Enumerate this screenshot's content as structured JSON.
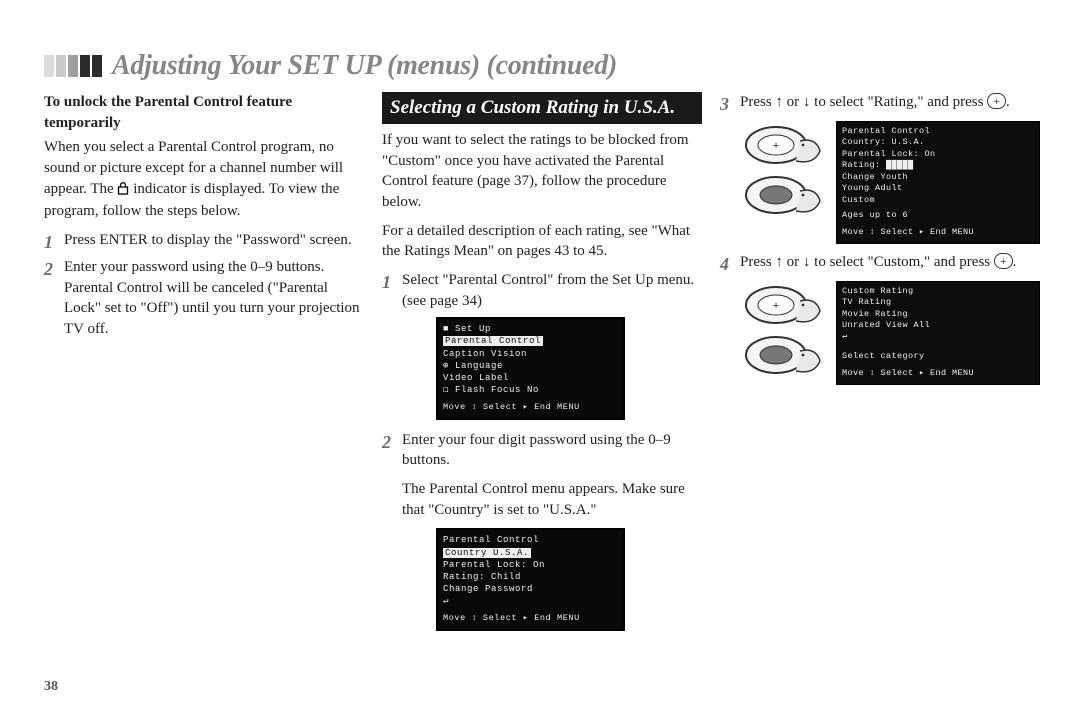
{
  "page_number": "38",
  "title": "Adjusting Your SET UP (menus) (continued)",
  "col1": {
    "subhead": "To unlock the Parental Control feature temporarily",
    "intro": "When you select a Parental Control program, no sound or picture except for a channel number will appear. The ",
    "intro2": " indicator is displayed. To view the program, follow the steps below.",
    "s1": "Press ENTER to display the \"Password\" screen.",
    "s2": "Enter your password using the 0–9 buttons. Parental Control will be canceled (\"Parental Lock\" set to \"Off\") until you turn your projection TV off."
  },
  "col2": {
    "boxtitle": "Selecting a Custom Rating in U.S.A.",
    "p1": "If you want to select the ratings to be blocked from \"Custom\" once you have activated the Parental Control feature (page 37), follow the procedure below.",
    "p2": "For a detailed description of each rating, see \"What the Ratings Mean\" on pages 43 to 45.",
    "s1": "Select \"Parental Control\" from the Set Up menu. (see page 34)",
    "s2a": "Enter your four digit password using the 0–9 buttons.",
    "s2b": "The Parental Control menu appears. Make sure that \"Country\" is set to \"U.S.A.\"",
    "osd1": {
      "title": "Set Up",
      "hl": "Parental Control",
      "l1": "Caption Vision",
      "l2": "Language",
      "l3": "Video Label",
      "l4": "Flash Focus    No",
      "foot": "Move ↕  Select ▸  End MENU"
    },
    "osd2": {
      "title": "Parental Control",
      "hl": "Country        U.S.A.",
      "l1": "Parental Lock: On",
      "l2": "Rating:        Child",
      "l3": "Change Password",
      "ret": "↵",
      "foot": "Move ↕  Select ▸  End MENU"
    }
  },
  "col3": {
    "s3": "Press ↑ or ↓ to select \"Rating,\" and press ",
    "s4": "Press ↑ or ↓ to select \"Custom,\" and press ",
    "plus": "+",
    "period": ".",
    "osd3": {
      "title": "Parental Control",
      "l1": "Country:  U.S.A.",
      "l2": "Parental Lock: On",
      "hl": "Rating:",
      "r1": "Change        Youth",
      "r2": "          Young Adult",
      "r3": "             Custom",
      "ages": "Ages up to 6",
      "foot": "Move ↕  Select ▸  End MENU"
    },
    "osd4": {
      "title": "Custom Rating",
      "hl": "TV Rating",
      "l1": "Movie Rating",
      "l2": "Unrated   View All",
      "ret": "↵",
      "note": "Select category",
      "foot": "Move ↕  Select ▸  End MENU"
    }
  }
}
